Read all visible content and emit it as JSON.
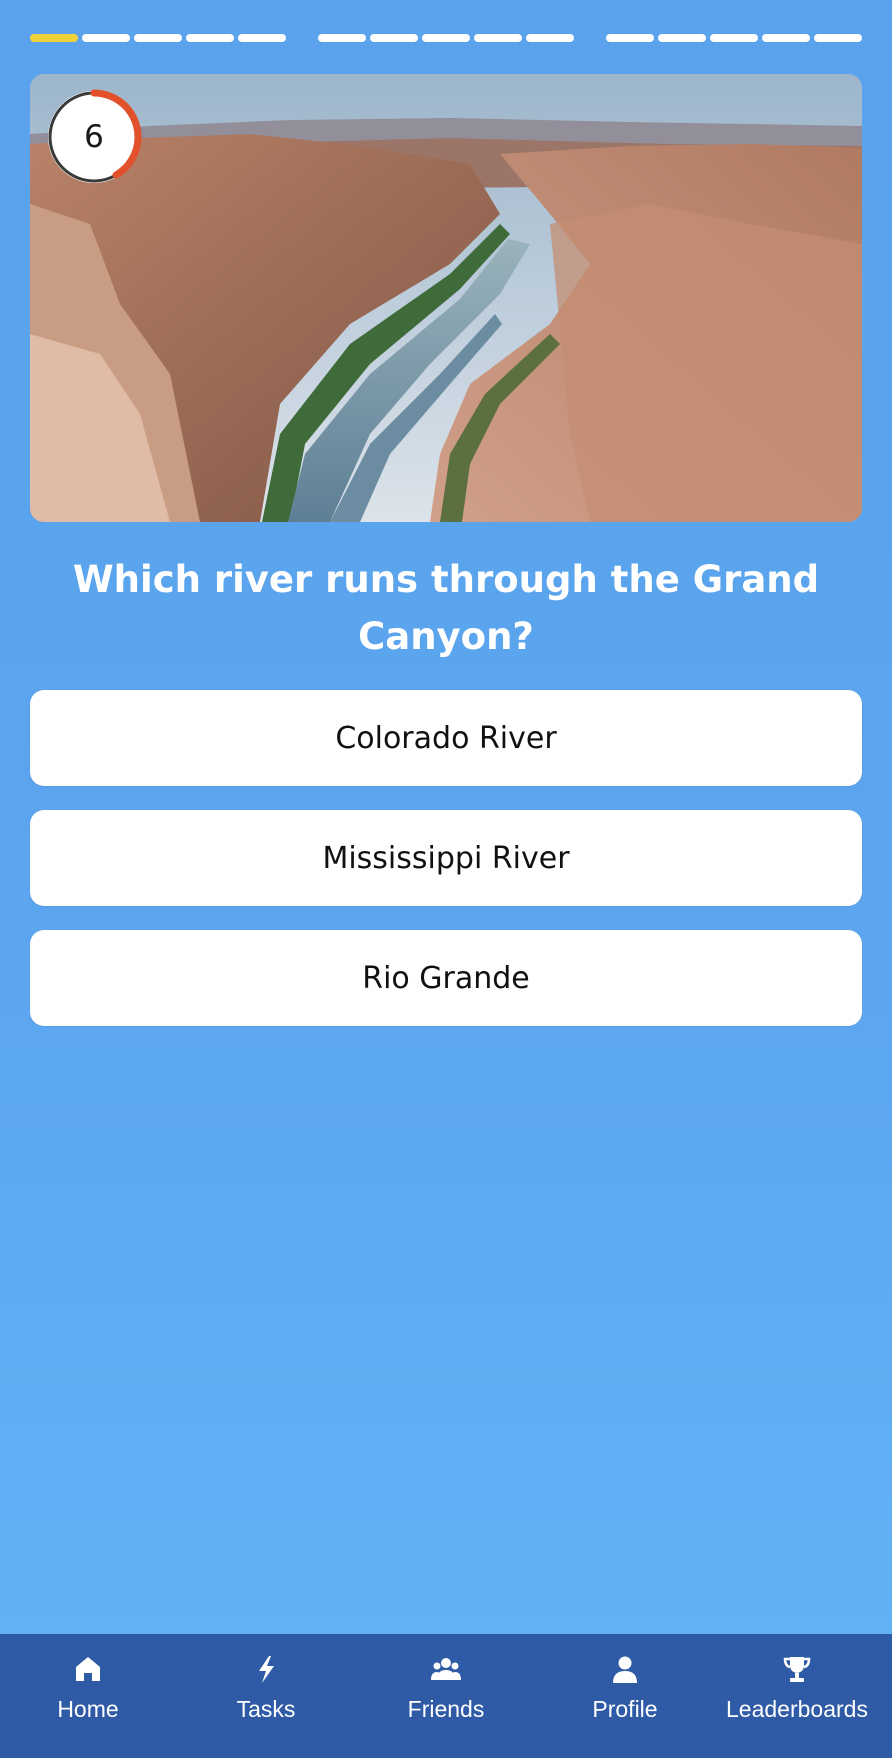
{
  "progress": {
    "current": 1,
    "total": 15,
    "active_color": "#F0D23A",
    "inactive_color": "#FFFFFF"
  },
  "hero": {
    "image": "grand-canyon-river-photo"
  },
  "timer": {
    "seconds": "6",
    "ring_color": "#E2512B"
  },
  "question": {
    "text": "Which river runs through the Grand Canyon?"
  },
  "answers": [
    {
      "label": "Colorado River"
    },
    {
      "label": "Mississippi River"
    },
    {
      "label": "Rio Grande"
    }
  ],
  "nav": {
    "background": "#2F5BA6",
    "items": [
      {
        "label": "Home",
        "icon": "home-icon"
      },
      {
        "label": "Tasks",
        "icon": "lightning-icon"
      },
      {
        "label": "Friends",
        "icon": "friends-icon"
      },
      {
        "label": "Profile",
        "icon": "user-icon"
      },
      {
        "label": "Leaderboards",
        "icon": "trophy-icon"
      }
    ]
  }
}
